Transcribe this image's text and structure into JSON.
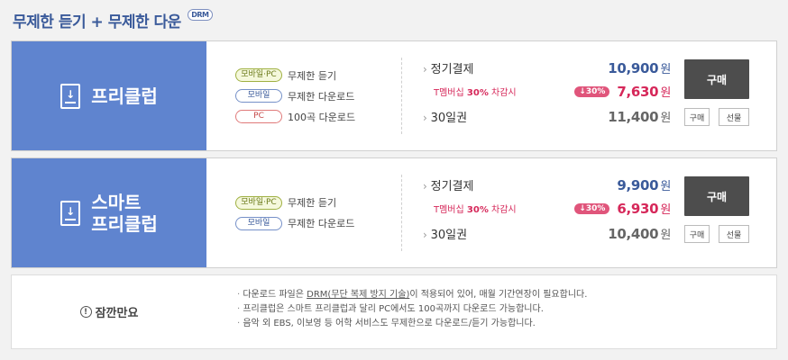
{
  "header": {
    "title": "무제한 듣기 + 무제한 다운",
    "badge": "DRM"
  },
  "plans": [
    {
      "name": "프리클럽",
      "features": [
        {
          "tag": "모바일·PC",
          "text": "무제한 듣기"
        },
        {
          "tag": "모바일",
          "text": "무제한 다운로드"
        },
        {
          "tag": "PC",
          "text": "100곡 다운로드"
        }
      ],
      "regular": {
        "label": "정기결제",
        "price": "10,900",
        "unit": "원"
      },
      "member": {
        "prefix": "T멤버십",
        "percent": "30%",
        "suffix": "차감시",
        "badge": "30%",
        "price": "7,630",
        "unit": "원"
      },
      "days30": {
        "label": "30일권",
        "price": "11,400",
        "unit": "원"
      },
      "buttons": {
        "buy": "구매",
        "buy_small": "구매",
        "gift": "선물"
      }
    },
    {
      "name_line1": "스마트",
      "name_line2": "프리클럽",
      "features": [
        {
          "tag": "모바일·PC",
          "text": "무제한 듣기"
        },
        {
          "tag": "모바일",
          "text": "무제한 다운로드"
        }
      ],
      "regular": {
        "label": "정기결제",
        "price": "9,900",
        "unit": "원"
      },
      "member": {
        "prefix": "T멤버십",
        "percent": "30%",
        "suffix": "차감시",
        "badge": "30%",
        "price": "6,930",
        "unit": "원"
      },
      "days30": {
        "label": "30일권",
        "price": "10,400",
        "unit": "원"
      },
      "buttons": {
        "buy": "구매",
        "buy_small": "구매",
        "gift": "선물"
      }
    }
  ],
  "notice": {
    "title": "잠깐만요",
    "line1_before": "다운로드 파일은 ",
    "line1_link": "DRM(무단 복제 방지 기술)",
    "line1_after": "이 적용되어 있어, 매월 기간연장이 필요합니다.",
    "line2": "프리클럽은 스마트 프리클럽과 달리 PC에서도 100곡까지 다운로드 가능합니다.",
    "line3": "음악 외 EBS, 이보영 등 어학 서비스도 무제한으로 다운로드/듣기 가능합니다."
  },
  "colors": {
    "plan_bg": "#5f84cf",
    "title": "#3a5a9a",
    "discount": "#d6285a",
    "buy_btn": "#4d4d4d"
  }
}
